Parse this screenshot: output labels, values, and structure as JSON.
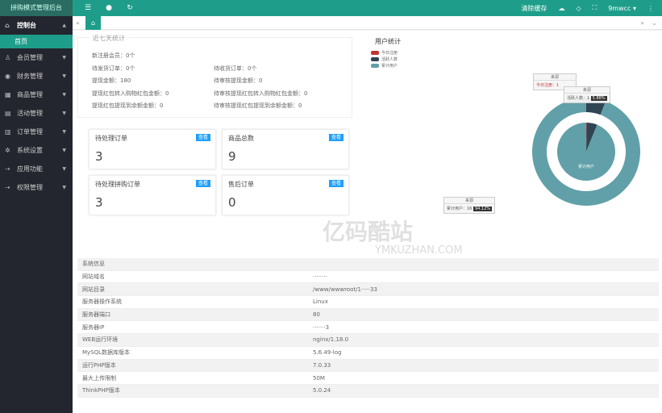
{
  "sidebar": {
    "logo": "拼购模式管理后台",
    "top": "控制台",
    "sub": "首页",
    "items": [
      {
        "label": "会员管理",
        "icon": "user-icon"
      },
      {
        "label": "财务管理",
        "icon": "finance-icon"
      },
      {
        "label": "商品管理",
        "icon": "goods-icon"
      },
      {
        "label": "活动管理",
        "icon": "activity-icon"
      },
      {
        "label": "订单管理",
        "icon": "order-icon"
      },
      {
        "label": "系统设置",
        "icon": "gear-icon"
      },
      {
        "label": "应用功能",
        "icon": "app-icon"
      },
      {
        "label": "权限管理",
        "icon": "permission-icon"
      }
    ]
  },
  "topbar": {
    "clear_cache": "清除缓存",
    "user": "9mwcc"
  },
  "stats": {
    "title": "近七天统计",
    "rows": [
      [
        "新注册会员：0个",
        ""
      ],
      [
        "待发货订单：0个",
        "待收货订单：0个"
      ],
      [
        "提现金额：180",
        "待审核提现金额：0"
      ],
      [
        "提现红包转入购物红包金额：0",
        "待审核提现红包转入购物红包金额：0"
      ],
      [
        "提现红包提现到余额金额：0",
        "待审核提现红包提现到余额金额：0"
      ]
    ]
  },
  "cards": [
    {
      "title": "待处理订单",
      "btn": "查看",
      "value": "3"
    },
    {
      "title": "商品总数",
      "btn": "查看",
      "value": "9"
    },
    {
      "title": "待处理拼购订单",
      "btn": "查看",
      "value": "3"
    },
    {
      "title": "售后订单",
      "btn": "查看",
      "value": "0"
    }
  ],
  "chart_data": {
    "type": "pie",
    "title": "用户统计",
    "legend": [
      "今日注册",
      "活跃人数",
      "累计用户"
    ],
    "colors": [
      "#c23531",
      "#2f4554",
      "#61a0a8"
    ],
    "outer": [
      {
        "name": "活跃人数",
        "value": 1
      },
      {
        "name": "累计用户",
        "value": 16
      }
    ],
    "inner": [
      {
        "name": "今日注册",
        "value": 0.05
      },
      {
        "name": "活跃人数",
        "value": 1
      },
      {
        "name": "累计用户",
        "value": 16
      }
    ],
    "tooltips": [
      {
        "head": "来源",
        "text": "今日注册：1"
      },
      {
        "head": "来源",
        "text": "活跃人数：1",
        "pct": "5.88%"
      },
      {
        "head": "来源",
        "text": "累计用户：16",
        "pct": "94.12%"
      }
    ],
    "inner_label": "累计用户"
  },
  "system": {
    "title": "系统信息",
    "rows": [
      [
        "网站域名",
        "········"
      ],
      [
        "网站目录",
        "/www/wwwroot/1·····33"
      ],
      [
        "服务器操作系统",
        "Linux"
      ],
      [
        "服务器端口",
        "80"
      ],
      [
        "服务器IP",
        "·······3"
      ],
      [
        "WEB运行环境",
        "nginx/1.18.0"
      ],
      [
        "MySQL数据库版本",
        "5.6.49-log"
      ],
      [
        "运行PHP版本",
        "7.0.33"
      ],
      [
        "最大上传限制",
        "50M"
      ],
      [
        "ThinkPHP版本",
        "5.0.24"
      ]
    ]
  },
  "watermark": {
    "cn": "亿码酷站",
    "en": "YMKUZHAN.COM"
  }
}
